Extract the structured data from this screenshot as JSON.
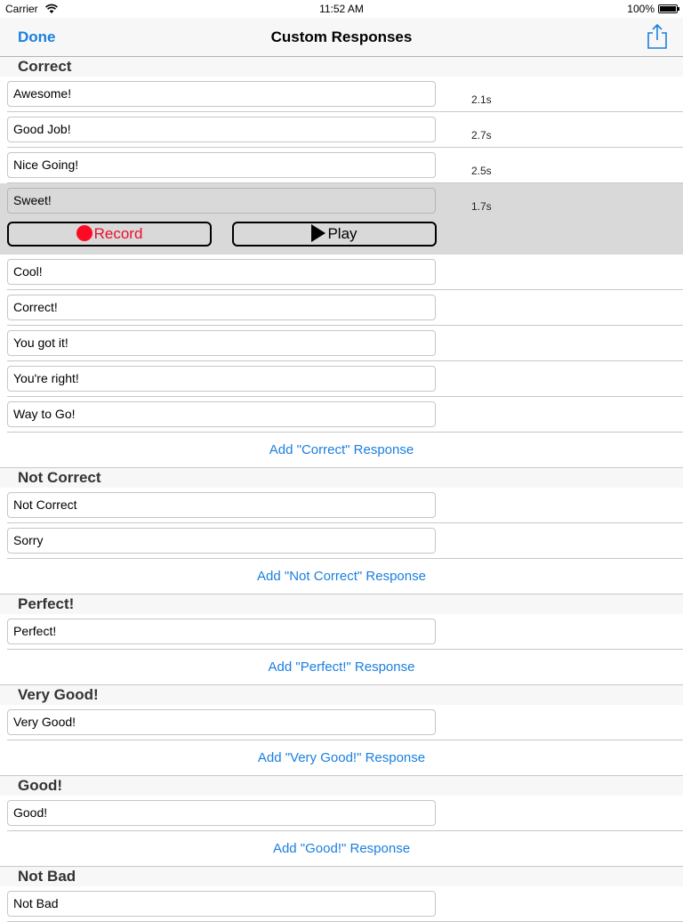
{
  "status_bar": {
    "carrier": "Carrier",
    "time": "11:52 AM",
    "battery": "100%"
  },
  "nav": {
    "done_label": "Done",
    "title": "Custom Responses",
    "share_icon": "share-icon"
  },
  "sections": {
    "correct": {
      "title": "Correct",
      "rows": [
        {
          "text": "Awesome!",
          "duration": "2.1s"
        },
        {
          "text": "Good Job!",
          "duration": "2.7s"
        },
        {
          "text": "Nice Going!",
          "duration": "2.5s"
        },
        {
          "text": "Sweet!",
          "duration": "1.7s",
          "record_label": "Record",
          "play_label": "Play"
        },
        {
          "text": "Cool!"
        },
        {
          "text": "Correct!"
        },
        {
          "text": "You got it!"
        },
        {
          "text": "You're right!"
        },
        {
          "text": "Way to Go!"
        }
      ],
      "add_label": "Add \"Correct\" Response"
    },
    "not_correct": {
      "title": "Not Correct",
      "rows": [
        {
          "text": "Not Correct"
        },
        {
          "text": "Sorry"
        }
      ],
      "add_label": "Add \"Not Correct\" Response"
    },
    "perfect": {
      "title": "Perfect!",
      "rows": [
        {
          "text": "Perfect!"
        }
      ],
      "add_label": "Add \"Perfect!\" Response"
    },
    "very_good": {
      "title": "Very Good!",
      "rows": [
        {
          "text": "Very Good!"
        }
      ],
      "add_label": "Add \"Very Good!\" Response"
    },
    "good": {
      "title": "Good!",
      "rows": [
        {
          "text": "Good!"
        }
      ],
      "add_label": "Add \"Good!\" Response"
    },
    "not_bad": {
      "title": "Not Bad",
      "rows": [
        {
          "text": "Not Bad"
        }
      ]
    }
  },
  "colors": {
    "accent": "#1a7fe0",
    "record": "#ff0a24",
    "selected_row": "#d9d9d9"
  }
}
